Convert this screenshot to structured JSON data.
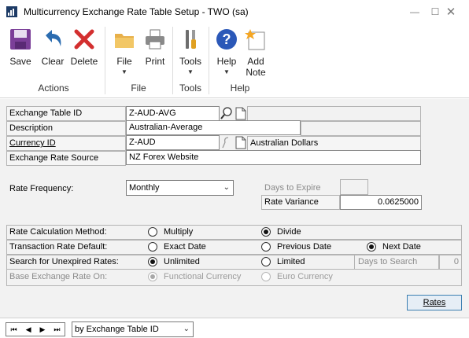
{
  "window": {
    "title": "Multicurrency Exchange Rate Table Setup  -  TWO (sa)",
    "controls": [
      "minimize-icon",
      "maximize-icon",
      "close-icon"
    ]
  },
  "ribbon": {
    "buttons": {
      "save": "Save",
      "clear": "Clear",
      "delete": "Delete",
      "file": "File",
      "print": "Print",
      "tools": "Tools",
      "help": "Help",
      "add_note": "Add\nNote"
    },
    "groups": {
      "actions": "Actions",
      "file": "File",
      "tools": "Tools",
      "help": "Help"
    }
  },
  "form": {
    "exchange_table_id": {
      "label": "Exchange Table ID",
      "value": "Z-AUD-AVG"
    },
    "description": {
      "label": "Description",
      "value": "Australian-Average"
    },
    "currency_id": {
      "label": "Currency ID",
      "value": "Z-AUD",
      "description": "Australian Dollars"
    },
    "exchange_rate_source": {
      "label": "Exchange Rate Source",
      "value": "NZ Forex Website"
    },
    "rate_frequency": {
      "label": "Rate Frequency:",
      "value": "Monthly"
    },
    "days_to_expire": {
      "label": "Days to Expire",
      "value": ""
    },
    "rate_variance": {
      "label": "Rate Variance",
      "value": "0.0625000"
    },
    "rate_calculation_method": {
      "label": "Rate Calculation Method:",
      "options": [
        "Multiply",
        "Divide"
      ],
      "selected": "Divide"
    },
    "transaction_rate_default": {
      "label": "Transaction Rate Default:",
      "options": [
        "Exact Date",
        "Previous Date",
        "Next Date"
      ],
      "selected": "Next Date"
    },
    "search_unexpired": {
      "label": "Search for Unexpired Rates:",
      "options": [
        "Unlimited",
        "Limited"
      ],
      "selected": "Unlimited"
    },
    "days_to_search": {
      "label": "Days to Search",
      "value": "0"
    },
    "base_exchange_rate_on": {
      "label": "Base Exchange Rate On:",
      "options": [
        "Functional Currency",
        "Euro Currency"
      ],
      "selected": "Functional Currency"
    },
    "rates_button": "Rates"
  },
  "statusbar": {
    "sort_by": "by Exchange Table ID"
  },
  "colors": {
    "accent": "#3c7fb1",
    "save_icon": "#7b3f98",
    "clear_icon": "#2b6cb0",
    "delete_icon": "#d32f2f",
    "help_icon": "#2b58b8"
  }
}
